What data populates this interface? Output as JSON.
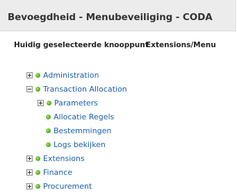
{
  "window": {
    "title": "Bevoegdheid - Menubeveiliging - CODA"
  },
  "selected_node": {
    "label": "Huidig geselecteerde knooppunt",
    "value": "Extensions/Menu"
  },
  "tree": {
    "items": [
      {
        "label": "Administration",
        "expander": "plus",
        "level": 0
      },
      {
        "label": "Transaction Allocation",
        "expander": "minus",
        "level": 0
      },
      {
        "label": "Parameters",
        "expander": "plus",
        "level": 1
      },
      {
        "label": "Allocatie Regels",
        "expander": "none",
        "level": 1
      },
      {
        "label": "Bestemmingen",
        "expander": "none",
        "level": 1
      },
      {
        "label": "Logs bekijken",
        "expander": "none",
        "level": 1
      },
      {
        "label": "Extensions",
        "expander": "plus",
        "level": 0
      },
      {
        "label": "Finance",
        "expander": "plus",
        "level": 0
      },
      {
        "label": "Procurement",
        "expander": "plus",
        "level": 0
      }
    ]
  },
  "colors": {
    "link": "#1a5fa6",
    "status_dot": "#5fb22a",
    "title_bar": "#ececec"
  }
}
